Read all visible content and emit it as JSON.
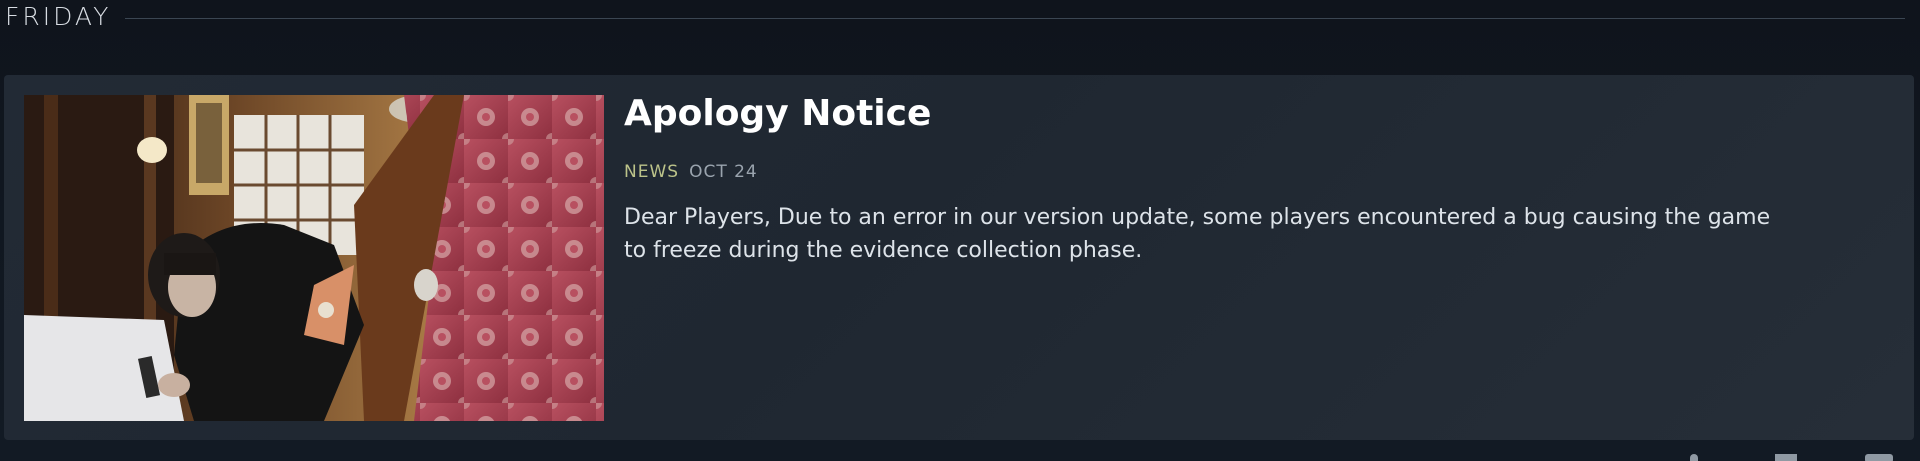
{
  "day_section": {
    "label": "FRIDAY"
  },
  "news_item": {
    "title": "Apology Notice",
    "type": "NEWS",
    "date": "OCT 24",
    "summary": "Dear Players, Due to an error in our version update, some players encountered a bug causing the game to freeze during the evidence collection phase."
  },
  "colors": {
    "background": "#111821",
    "card": "#222a35",
    "meta_type": "#bcc38a",
    "meta_date": "#9aa4ae"
  }
}
